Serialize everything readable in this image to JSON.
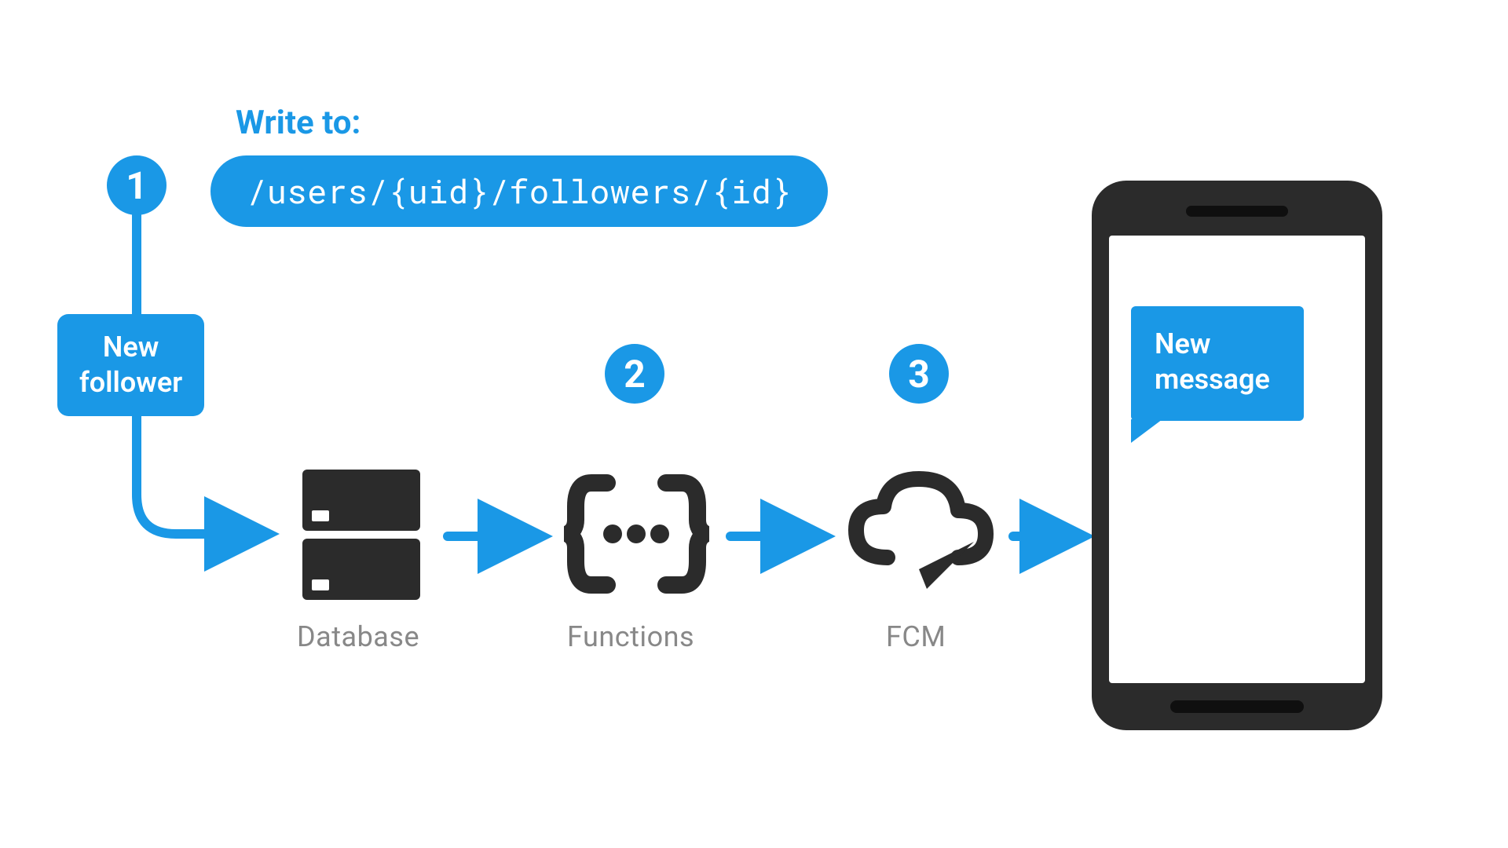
{
  "write_label": "Write to:",
  "path": "/users/{uid}/followers/{id}",
  "steps": {
    "one": "1",
    "two": "2",
    "three": "3"
  },
  "new_follower": {
    "line1": "New",
    "line2": "follower"
  },
  "nodes": {
    "database": "Database",
    "functions": "Functions",
    "fcm": "FCM"
  },
  "phone_bubble": {
    "line1": "New",
    "line2": "message"
  },
  "colors": {
    "blue": "#1a98e6",
    "dark": "#2b2b2b",
    "gray": "#888"
  }
}
